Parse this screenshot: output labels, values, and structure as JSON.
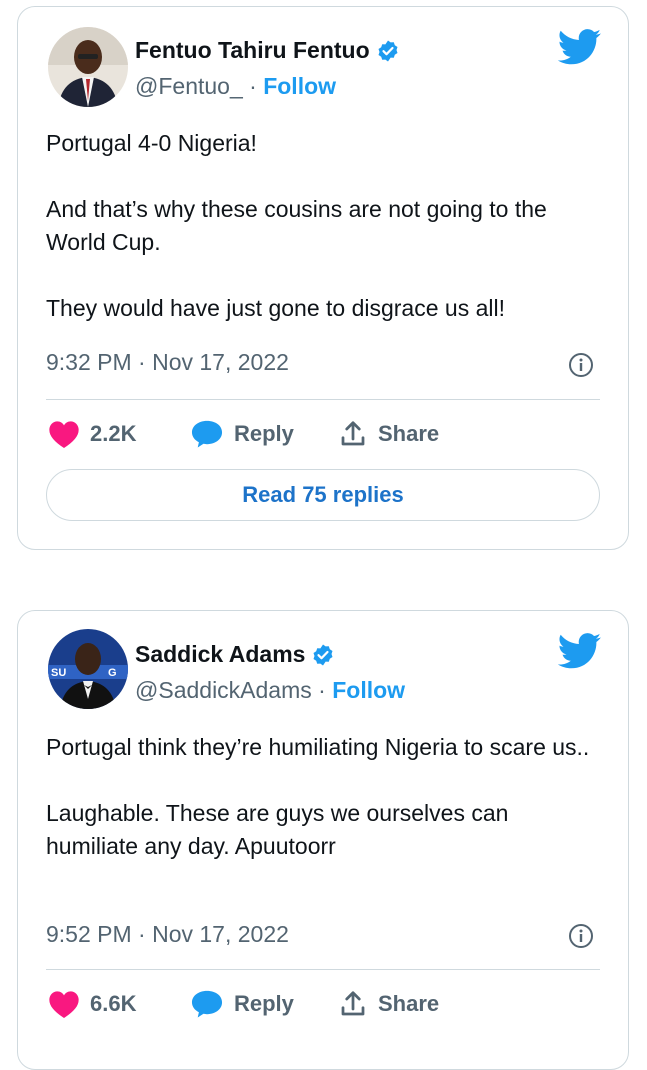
{
  "tweets": [
    {
      "author_name": "Fentuo Tahiru Fentuo",
      "handle": "@Fentuo_",
      "follow_label": "Follow",
      "separator": " · ",
      "paragraphs": [
        "Portugal 4-0 Nigeria!",
        "And that’s why these cousins are not going to the World Cup.",
        "They would have just gone to disgrace us all!"
      ],
      "timestamp": "9:32 PM · Nov 17, 2022",
      "likes": "2.2K",
      "reply_label": "Reply",
      "share_label": "Share",
      "read_replies": "Read 75 replies"
    },
    {
      "author_name": "Saddick Adams",
      "handle": "@SaddickAdams",
      "follow_label": "Follow",
      "separator": " · ",
      "paragraphs": [
        "Portugal think they’re humiliating Nigeria to scare us..",
        "Laughable. These are guys we ourselves can humiliate any day. Apuutoorr"
      ],
      "timestamp": "9:52 PM · Nov 17, 2022",
      "likes": "6.6K",
      "reply_label": "Reply",
      "share_label": "Share"
    }
  ],
  "colors": {
    "like": "#f91880",
    "reply": "#1d9bf0",
    "twitter_blue": "#1d9bf0",
    "follow": "#1d9bf0",
    "border": "#cfd9de",
    "secondary_text": "#536471"
  },
  "icons": [
    "twitter-bird-icon",
    "verified-badge-icon",
    "info-icon",
    "heart-icon",
    "reply-bubble-icon",
    "share-icon"
  ]
}
